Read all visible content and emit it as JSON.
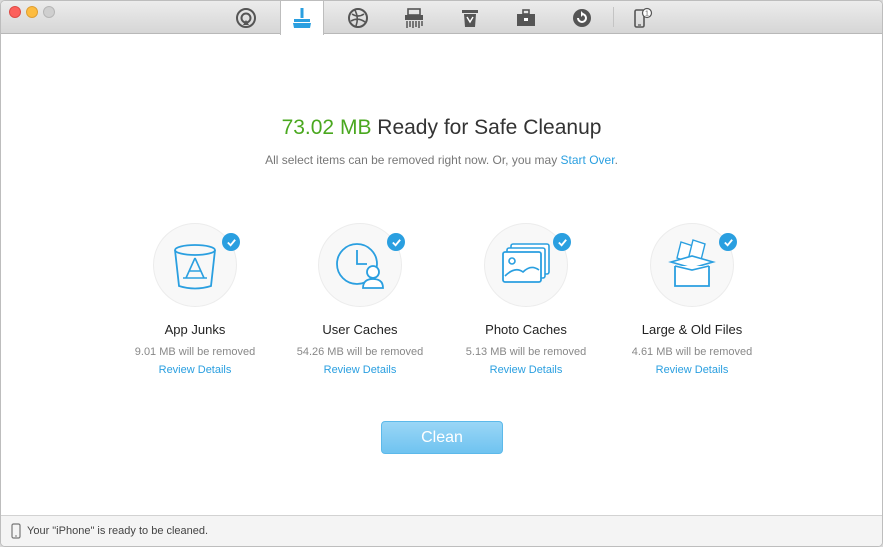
{
  "headline": {
    "size": "73.02 MB",
    "text": " Ready for Safe Cleanup"
  },
  "subline": {
    "text": "All select items can be removed right now. Or, you may ",
    "link": "Start Over",
    "suffix": "."
  },
  "toolbar": {
    "items": [
      {
        "icon": "airplay-icon"
      },
      {
        "icon": "brush-clean-icon",
        "active": true
      },
      {
        "icon": "internet-globe-icon"
      },
      {
        "icon": "shredder-icon"
      },
      {
        "icon": "trash-bin-icon"
      },
      {
        "icon": "toolbox-icon"
      },
      {
        "icon": "refresh-backup-icon"
      },
      {
        "icon": "device-badge-icon",
        "badge": "1"
      }
    ]
  },
  "categories": [
    {
      "title": "App Junks",
      "size": "9.01 MB will be removed",
      "link": "Review Details",
      "icon": "app-trash-icon"
    },
    {
      "title": "User Caches",
      "size": "54.26 MB will be removed",
      "link": "Review Details",
      "icon": "user-clock-icon"
    },
    {
      "title": "Photo Caches",
      "size": "5.13 MB will be removed",
      "link": "Review Details",
      "icon": "photo-stack-icon"
    },
    {
      "title": "Large & Old Files",
      "size": "4.61 MB will be removed",
      "link": "Review Details",
      "icon": "file-box-icon"
    }
  ],
  "clean_button": "Clean",
  "status": "Your \"iPhone\" is ready to be cleaned.",
  "colors": {
    "accent": "#2a9fe0",
    "size_green": "#4aa81f"
  }
}
